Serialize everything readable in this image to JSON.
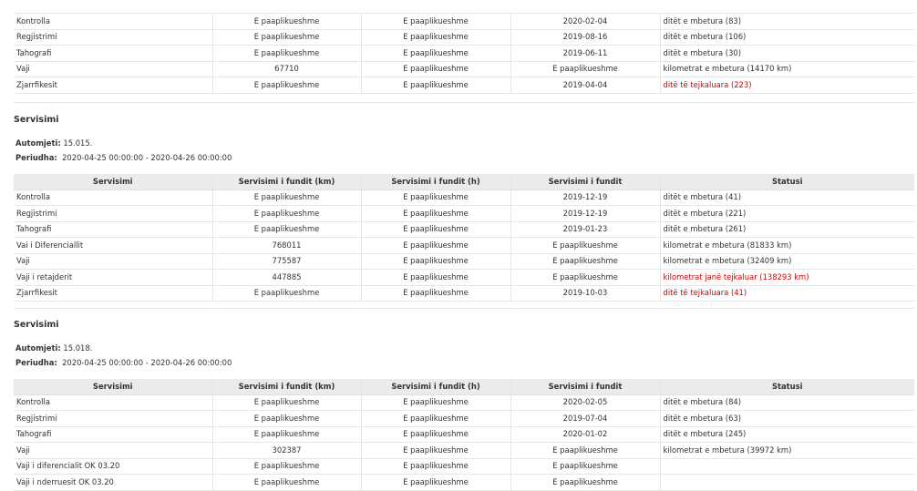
{
  "top_table": {
    "rows": [
      [
        "Kontrolla",
        "E paaplikueshme",
        "E paaplikueshme",
        "2020-02-04",
        "ditët e mbetura (83)"
      ],
      [
        "Regjistrimi",
        "E paaplikueshme",
        "E paaplikueshme",
        "2019-08-16",
        "ditët e mbetura (106)"
      ],
      [
        "Tahografi",
        "E paaplikueshme",
        "E paaplikueshme",
        "2019-06-11",
        "ditët e mbetura (30)"
      ],
      [
        "Vaji",
        "67710",
        "E paaplikueshme",
        "E paaplikueshme",
        "kilometrat e mbetura (14170 km)"
      ],
      [
        "Zjarrfikesit",
        "E paaplikueshme",
        "E paaplikueshme",
        "2019-04-04",
        "ditë të tejkaluara (223)"
      ]
    ],
    "overdue_rows": [
      4
    ]
  },
  "headers": [
    "Servisimi",
    "Servisimi i fundit (km)",
    "Servisimi i fundit (h)",
    "Servisimi i fundit",
    "Statusi"
  ],
  "sections": [
    {
      "title": "Servisimi",
      "vehicle_label": "Automjeti:",
      "vehicle": "15.015.",
      "period_label": "Periudha:",
      "period": "2020-04-25 00:00:00 - 2020-04-26 00:00:00",
      "rows": [
        [
          "Kontrolla",
          "E paaplikueshme",
          "E paaplikueshme",
          "2019-12-19",
          "ditët e mbetura (41)"
        ],
        [
          "Regjistrimi",
          "E paaplikueshme",
          "E paaplikueshme",
          "2019-12-19",
          "ditët e mbetura (221)"
        ],
        [
          "Tahografi",
          "E paaplikueshme",
          "E paaplikueshme",
          "2019-01-23",
          "ditët e mbetura (261)"
        ],
        [
          "Vai i Diferenciallit",
          "768011",
          "E paaplikueshme",
          "E paaplikueshme",
          "kilometrat e mbetura (81833 km)"
        ],
        [
          "Vaji",
          "775587",
          "E paaplikueshme",
          "E paaplikueshme",
          "kilometrat e mbetura (32409 km)"
        ],
        [
          "Vaji i retajderit",
          "447885",
          "E paaplikueshme",
          "E paaplikueshme",
          "kilometrat janë tejkaluar (138293 km)"
        ],
        [
          "Zjarrfikesit",
          "E paaplikueshme",
          "E paaplikueshme",
          "2019-10-03",
          "ditë të tejkaluara (41)"
        ]
      ],
      "overdue_rows": [
        5,
        6
      ]
    },
    {
      "title": "Servisimi",
      "vehicle_label": "Automjeti:",
      "vehicle": "15.018.",
      "period_label": "Periudha:",
      "period": "2020-04-25 00:00:00 - 2020-04-26 00:00:00",
      "rows": [
        [
          "Kontrolla",
          "E paaplikueshme",
          "E paaplikueshme",
          "2020-02-05",
          "ditët e mbetura (84)"
        ],
        [
          "Regjistrimi",
          "E paaplikueshme",
          "E paaplikueshme",
          "2019-07-04",
          "ditët e mbetura (63)"
        ],
        [
          "Tahografi",
          "E paaplikueshme",
          "E paaplikueshme",
          "2020-01-02",
          "ditët e mbetura (245)"
        ],
        [
          "Vaji",
          "302387",
          "E paaplikueshme",
          "E paaplikueshme",
          "kilometrat e mbetura (39972 km)"
        ],
        [
          "Vaji i diferencialit OK 03.20",
          "E paaplikueshme",
          "E paaplikueshme",
          "E paaplikueshme",
          ""
        ],
        [
          "Vaji i nderruesit OK 03.20",
          "E paaplikueshme",
          "E paaplikueshme",
          "E paaplikueshme",
          ""
        ]
      ],
      "overdue_rows": []
    }
  ],
  "colors": {
    "overdue": "#d00000",
    "header_bg": "#ebebeb",
    "text": "#333333"
  }
}
